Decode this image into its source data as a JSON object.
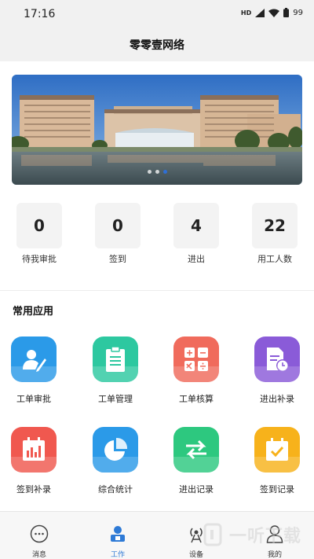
{
  "status_bar": {
    "time": "17:16",
    "network": "HD",
    "battery": "99"
  },
  "header": {
    "title": "零零壹网络"
  },
  "banner": {
    "slide_count": 3,
    "active_slide": 3
  },
  "stats": [
    {
      "value": "0",
      "label": "待我审批"
    },
    {
      "value": "0",
      "label": "签到"
    },
    {
      "value": "4",
      "label": "进出"
    },
    {
      "value": "22",
      "label": "用工人数"
    }
  ],
  "apps_section": {
    "title": "常用应用"
  },
  "apps": [
    {
      "label": "工单审批",
      "icon": "user-edit-icon",
      "color": "#2b9ae8"
    },
    {
      "label": "工单管理",
      "icon": "clipboard-icon",
      "color": "#2dc8a0"
    },
    {
      "label": "工单核算",
      "icon": "calculator-icon",
      "color": "#f06b5c"
    },
    {
      "label": "进出补录",
      "icon": "document-clock-icon",
      "color": "#8a5bd8"
    },
    {
      "label": "签到补录",
      "icon": "calendar-chart-icon",
      "color": "#f0584f"
    },
    {
      "label": "综合统计",
      "icon": "pie-chart-icon",
      "color": "#2b9ae8"
    },
    {
      "label": "进出记录",
      "icon": "transfer-arrows-icon",
      "color": "#2dc87f"
    },
    {
      "label": "签到记录",
      "icon": "calendar-check-icon",
      "color": "#f7b21b"
    }
  ],
  "tabs": [
    {
      "label": "消息",
      "icon": "message-icon"
    },
    {
      "label": "工作",
      "icon": "work-icon"
    },
    {
      "label": "设备",
      "icon": "device-icon"
    },
    {
      "label": "我的",
      "icon": "profile-icon"
    }
  ],
  "active_tab": "工作",
  "watermark": {
    "text": "一听下载"
  }
}
